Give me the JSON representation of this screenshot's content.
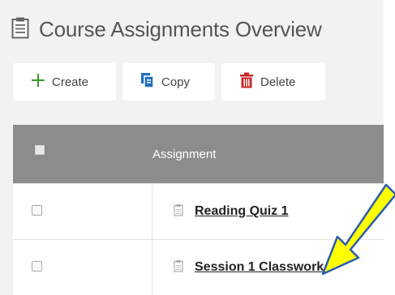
{
  "header": {
    "title": "Course Assignments Overview",
    "icon": "clipboard-icon"
  },
  "toolbar": {
    "create_label": "Create",
    "copy_label": "Copy",
    "delete_label": "Delete",
    "colors": {
      "create": "#3a9a2a",
      "copy": "#1f6fc2",
      "delete": "#c62828"
    }
  },
  "table": {
    "header_label": "Assignment",
    "header_bg": "#8c8c8c",
    "rows": [
      {
        "name": "Reading Quiz 1"
      },
      {
        "name": "Session 1 Classwork"
      }
    ]
  },
  "annotation": {
    "arrow_color": "#ffff00",
    "points_to": "Session 1 Classwork"
  }
}
